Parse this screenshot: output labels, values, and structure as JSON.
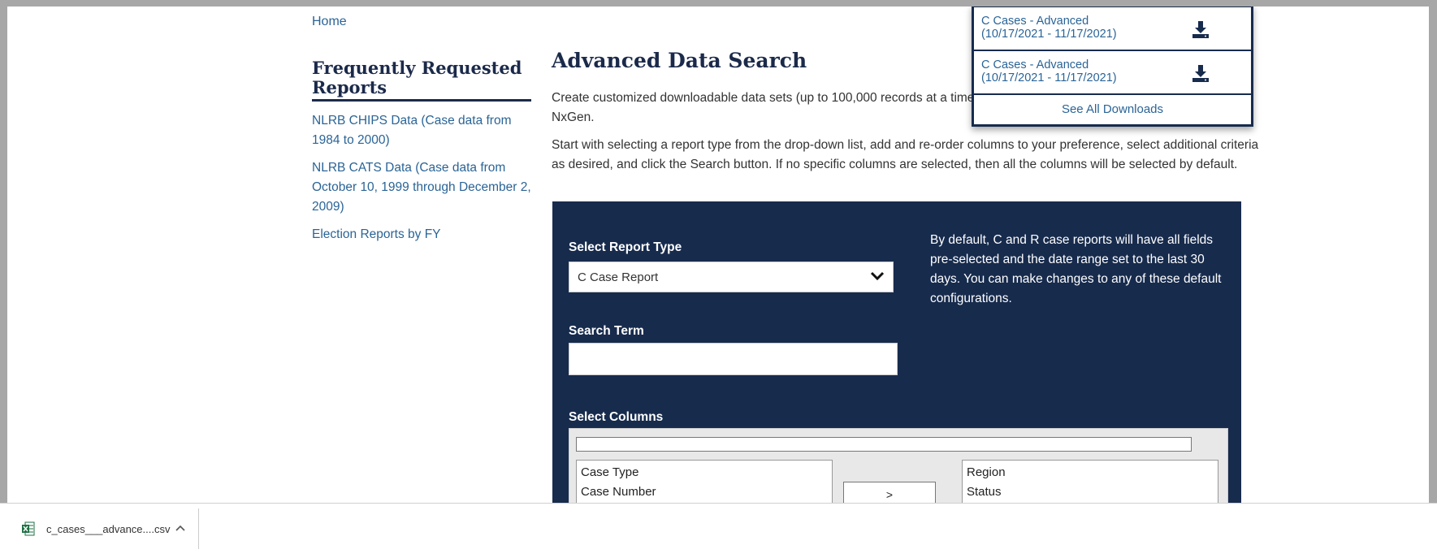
{
  "breadcrumb": {
    "home": "Home"
  },
  "sidebar": {
    "title": "Frequently Requested Reports",
    "items": [
      {
        "label": "NLRB CHIPS Data  (Case data from 1984 to 2000)"
      },
      {
        "label": "NLRB CATS Data  (Case data from October 10, 1999 through December 2, 2009)"
      },
      {
        "label": "Election Reports by FY"
      }
    ]
  },
  "main": {
    "title": "Advanced Data Search",
    "para1": "Create customized downloadable data sets (up to 100,000 records at a time) contained in the Agency’s casehandling system, NxGen.",
    "para2": "Start with selecting a report type from the drop-down list, add and re-order columns to your preference, select additional criteria as desired, and click the Search button. If no specific columns are selected, then all the columns will be selected by default."
  },
  "panel": {
    "report_type_label": "Select Report Type",
    "report_type_value": "C Case Report",
    "help_text": "By default, C and R case reports will have all fields pre-selected and the date range set to the last 30 days. You can make changes to any of these default configurations.",
    "search_label": "Search Term",
    "search_value": "",
    "columns_label": "Select Columns",
    "available_columns": [
      "Case Type",
      "Case Number"
    ],
    "selected_columns": [
      "Region",
      "Status"
    ],
    "move_button": ">"
  },
  "downloads": {
    "items": [
      {
        "line1": "C Cases - Advanced",
        "line2": "(10/17/2021 - 11/17/2021)"
      },
      {
        "line1": "C Cases - Advanced",
        "line2": "(10/17/2021 - 11/17/2021)"
      }
    ],
    "see_all": "See All Downloads"
  },
  "download_bar": {
    "file_name": "c_cases___advance....csv"
  },
  "colors": {
    "navy": "#172b4d",
    "link": "#2a6496",
    "excel_green": "#1d6f42"
  }
}
